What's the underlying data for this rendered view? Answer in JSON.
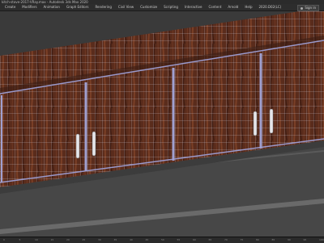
{
  "window": {
    "title": "kitch-stove-2017-VRay.max - Autodesk 3ds Max 2020"
  },
  "menu": {
    "items": [
      "Create",
      "Modifiers",
      "Animation",
      "Graph Editors",
      "Rendering",
      "Civil View",
      "Customize",
      "Scripting",
      "Interactive",
      "Content",
      "Arnold",
      "Help",
      "2020.D02(LC)"
    ]
  },
  "account": {
    "signin_label": "Sign in"
  },
  "timeline": {
    "ticks": [
      "0",
      "5",
      "10",
      "15",
      "20",
      "25",
      "30",
      "35",
      "40",
      "45",
      "50",
      "55",
      "60",
      "65",
      "70",
      "75",
      "80",
      "85",
      "90",
      "95",
      "100"
    ]
  },
  "colors": {
    "wood": "#5a2d1d",
    "wireframe": "#d8d8e8",
    "frame": "#8c8cc8",
    "ground": "#4a4a4a"
  }
}
